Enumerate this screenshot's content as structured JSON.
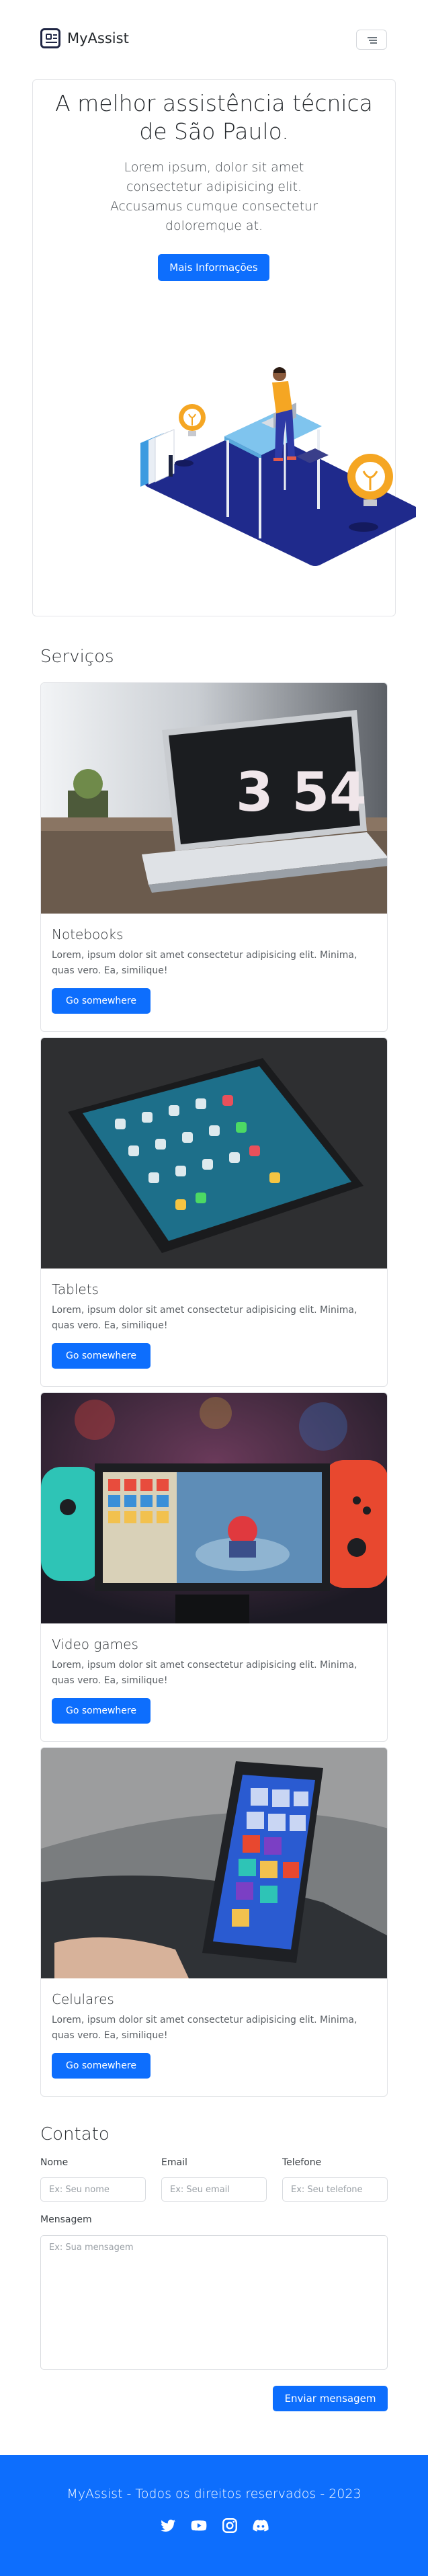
{
  "navbar": {
    "brand": "MyAssist"
  },
  "hero": {
    "title": "A melhor assistência técnica de São Paulo.",
    "text": "Lorem ipsum, dolor sit amet consectetur adipisicing elit. Accusamus cumque consectetur doloremque at.",
    "button": "Mais Informações"
  },
  "services": {
    "title": "Serviços",
    "cards": [
      {
        "title": "Notebooks",
        "text": "Lorem, ipsum dolor sit amet consectetur adipisicing elit. Minima, quas vero. Ea, similique!",
        "button": "Go somewhere",
        "image_label": "3 54"
      },
      {
        "title": "Tablets",
        "text": "Lorem, ipsum dolor sit amet consectetur adipisicing elit. Minima, quas vero. Ea, similique!",
        "button": "Go somewhere"
      },
      {
        "title": "Video games",
        "text": "Lorem, ipsum dolor sit amet consectetur adipisicing elit. Minima, quas vero. Ea, similique!",
        "button": "Go somewhere"
      },
      {
        "title": "Celulares",
        "text": "Lorem, ipsum dolor sit amet consectetur adipisicing elit. Minima, quas vero. Ea, similique!",
        "button": "Go somewhere"
      }
    ]
  },
  "contact": {
    "title": "Contato",
    "name_label": "Nome",
    "name_placeholder": "Ex: Seu nome",
    "email_label": "Email",
    "email_placeholder": "Ex: Seu email",
    "phone_label": "Telefone",
    "phone_placeholder": "Ex: Seu telefone",
    "message_label": "Mensagem",
    "message_placeholder": "Ex: Sua mensagem",
    "submit": "Enviar mensagem"
  },
  "footer": {
    "text": "MyAssist - Todos os direitos reservados - 2023",
    "social_icons": [
      "twitter-icon",
      "youtube-icon",
      "instagram-icon",
      "discord-icon"
    ]
  },
  "colors": {
    "primary": "#0d6efd",
    "illustration_navy": "#1f2a8c",
    "lamp_orange": "#f5a623"
  }
}
